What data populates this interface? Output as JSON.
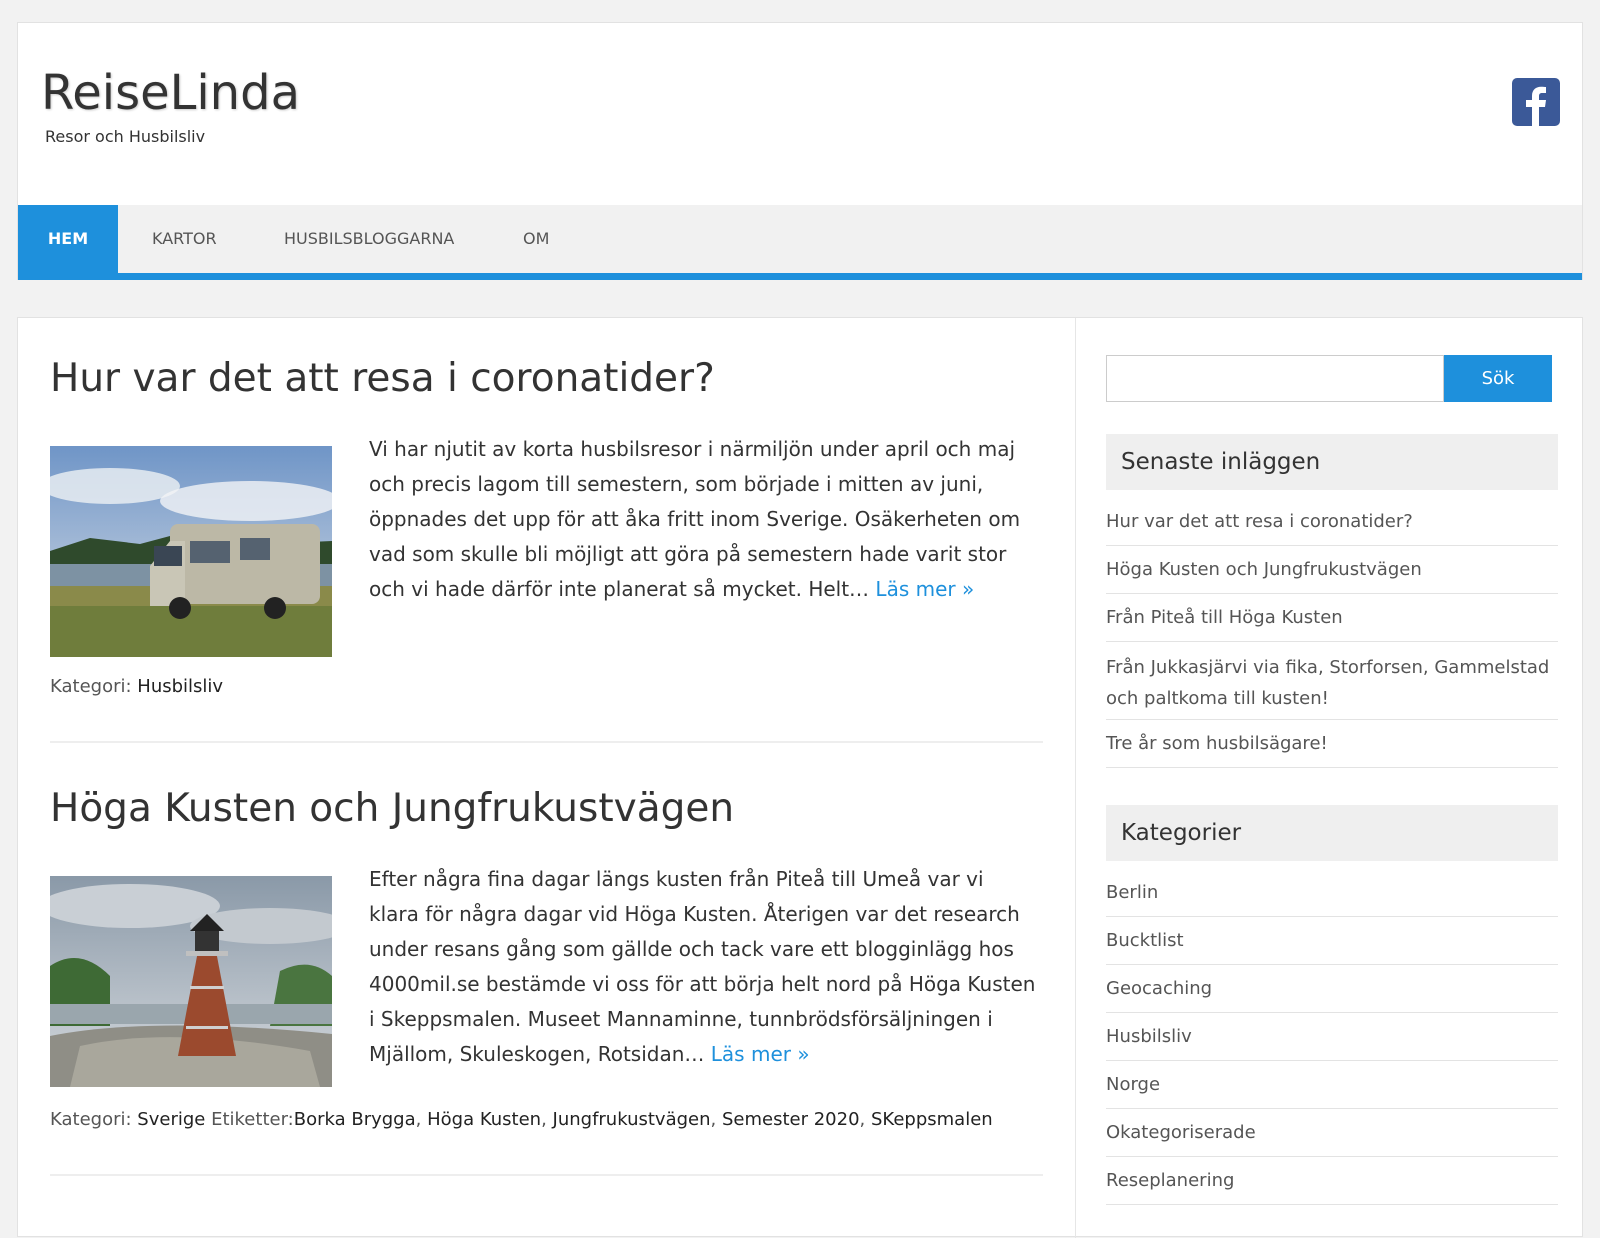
{
  "site": {
    "title": "ReiseLinda",
    "description": "Resor och Husbilsliv"
  },
  "social": {
    "facebook_icon": "facebook-icon"
  },
  "nav": {
    "items": [
      {
        "label": "HEM",
        "active": true
      },
      {
        "label": "KARTOR",
        "active": false
      },
      {
        "label": "HUSBILSBLOGGARNA",
        "active": false
      },
      {
        "label": "OM",
        "active": false
      }
    ]
  },
  "posts": [
    {
      "title": "Hur var det att resa i coronatider?",
      "excerpt": "Vi har njutit av korta husbilsresor i närmiljön under april och maj och precis lagom till semestern, som började i mitten av juni, öppnades det upp för att åka fritt inom Sverige. Osäkerheten om vad som skulle bli möjligt att göra på semestern hade varit stor och vi hade därför inte planerat så mycket. Helt…",
      "more": "Läs mer »",
      "category_label": "Kategori:",
      "category": "Husbilsliv"
    },
    {
      "title": "Höga Kusten och Jungfrukustvägen",
      "excerpt": "Efter några fina dagar längs kusten från Piteå till Umeå var vi klara för några dagar vid Höga Kusten. Återigen var det research under resans gång som gällde och tack vare ett blogginlägg hos 4000mil.se be­stämde vi oss för att börja helt nord på Höga Kusten i Skeppsmalen. Museet Mannaminne, tunnbrödsförsäljningen i Mjällom, Skuleskogen, Rotsidan…",
      "more": "Läs mer »",
      "category_label": "Kategori:",
      "category": "Sverige",
      "tags_label": "Etiketter:",
      "tags": [
        "Borka Brygga",
        "Höga Kusten",
        "Jungfrukustvägen",
        "Semester 2020",
        "SKeppsmalen"
      ]
    }
  ],
  "sidebar": {
    "search": {
      "placeholder": "",
      "button": "Sök"
    },
    "recent": {
      "title": "Senaste inläggen",
      "items": [
        "Hur var det att resa i coronatider?",
        "Höga Kusten och Jungfrukustvägen",
        "Från Piteå till Höga Kusten",
        "Från Jukkasjärvi via fika, Storforsen, Gammelstad och paltkoma till kusten!",
        "Tre år som husbilsägare!"
      ]
    },
    "categories": {
      "title": "Kategorier",
      "items": [
        "Berlin",
        "Bucktlist",
        "Geocaching",
        "Husbilsliv",
        "Norge",
        "Okategoriserade",
        "Reseplanering"
      ]
    }
  },
  "colors": {
    "accent": "#1e90dc",
    "facebook": "#3b5998"
  }
}
